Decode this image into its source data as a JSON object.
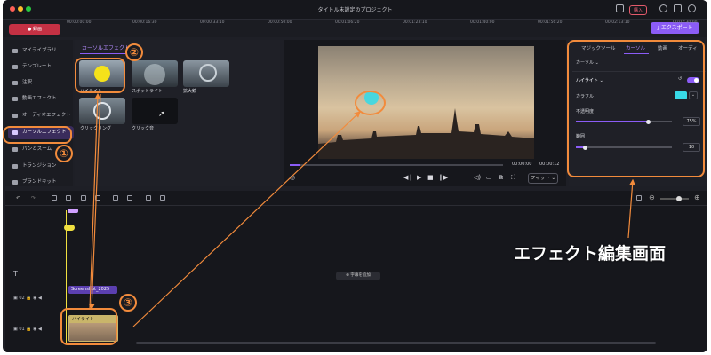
{
  "window": {
    "title": "タイトル未設定のプロジェクト",
    "buy_label": "購入"
  },
  "toolbar": {
    "record_label": "● 録画",
    "export_label": "⤓ エクスポート"
  },
  "sidebar": {
    "items": [
      {
        "label": "マイライブラリ"
      },
      {
        "label": "テンプレート"
      },
      {
        "label": "注釈"
      },
      {
        "label": "動画エフェクト"
      },
      {
        "label": "オーディオエフェクト"
      },
      {
        "label": "カーソルエフェクト"
      },
      {
        "label": "パンとズーム"
      },
      {
        "label": "トランジション"
      },
      {
        "label": "ブランドキット"
      }
    ]
  },
  "effects_panel": {
    "title": "カーソルエフェクト",
    "items": [
      {
        "label": "ハイライト"
      },
      {
        "label": "スポットライト"
      },
      {
        "label": "拡大鏡"
      },
      {
        "label": "クリックリング"
      },
      {
        "label": "クリック音"
      }
    ]
  },
  "preview": {
    "time_current": "00:00:00",
    "time_total": "00:00:12",
    "fit_label": "フィット ⌄",
    "progress_fraction": 0.05
  },
  "right_panel": {
    "tabs": [
      "マジックツール",
      "カーソル",
      "動画",
      "オーディ"
    ],
    "active_tab": "カーソル",
    "section_label": "カーソル ⌄",
    "effect_label": "ハイライト ⌄",
    "color_label": "カラフル",
    "opacity_label": "不透明度",
    "opacity_value": "75%",
    "opacity_fraction": 0.75,
    "range_label": "範囲",
    "range_value": "10",
    "range_fraction": 0.1,
    "highlight_color": "#38d9e6"
  },
  "timeline": {
    "ruler_ticks": [
      "00:00:00:00",
      "00:00:16:30",
      "00:00:33:10",
      "00:00:50:00",
      "00:01:06:20",
      "00:01:23:10",
      "00:01:40:00",
      "00:01:56:20",
      "00:02:13:10",
      "00:02:30:00"
    ],
    "add_subtitle_label": "⊕ 字幕を追加",
    "clip_a_label": "Screenshot_2025",
    "clip_b_label": "ハイライト",
    "track_labels": [
      "T",
      "02",
      "01"
    ]
  },
  "annotation": {
    "numbers": [
      "①",
      "②",
      "③"
    ],
    "caption": "エフェクト編集画面",
    "accent_color": "#f28b3c"
  }
}
